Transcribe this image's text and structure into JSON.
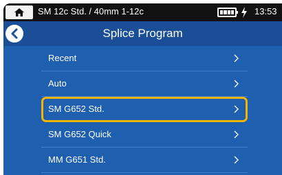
{
  "statusbar": {
    "title": "SM 12c Std. / 40mm 1-12c",
    "time": "13:53",
    "battery_level": 1.0
  },
  "header": {
    "title": "Splice Program"
  },
  "menu": {
    "items": [
      {
        "label": "Recent",
        "selected": false
      },
      {
        "label": "Auto",
        "selected": false
      },
      {
        "label": "SM G652 Std.",
        "selected": true
      },
      {
        "label": "SM G652 Quick",
        "selected": false
      },
      {
        "label": "MM G651 Std.",
        "selected": false
      }
    ]
  },
  "colors": {
    "background": "#1f5fb0",
    "header": "#1a4f98",
    "statusbar": "#111111",
    "highlight": "#f5b400"
  },
  "icons": {
    "home": "home-icon",
    "back": "back-arrow-icon",
    "chevron": "chevron-right-icon",
    "battery": "battery-icon",
    "charging": "charging-icon"
  }
}
